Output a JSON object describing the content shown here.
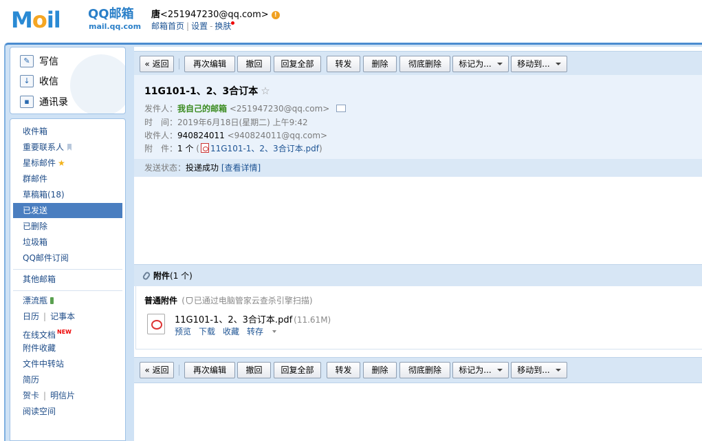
{
  "header": {
    "logo_text_m": "M",
    "logo_text_o": "o",
    "logo_text_il": "il",
    "logo_cn": "QQ邮箱",
    "logo_domain": "mail.qq.com",
    "user_name": "唐",
    "user_email": "<251947230@qq.com>",
    "warn_icon": "!",
    "links": {
      "home": "邮箱首页",
      "sep": "|",
      "settings": "设置",
      "dash": "-",
      "skin": "换肤"
    }
  },
  "sidebar": {
    "compose": "写信",
    "receive": "收信",
    "contacts": "通讯录",
    "folders": {
      "inbox": "收件箱",
      "vip": "重要联系人",
      "starred": "星标邮件",
      "groups": "群邮件",
      "drafts": "草稿箱(18)",
      "sent": "已发送",
      "deleted": "已删除",
      "spam": "垃圾箱",
      "subscriptions": "QQ邮件订阅",
      "other": "其他邮箱",
      "bottle": "漂流瓶",
      "calendar": "日历",
      "notes": "记事本",
      "docs": "在线文档",
      "new_badge": "NEW",
      "attach_fav": "附件收藏",
      "transfer": "文件中转站",
      "resume": "简历",
      "cards": "贺卡",
      "postcards": "明信片",
      "reading": "阅读空间",
      "vsep": "|"
    }
  },
  "toolbar": {
    "back": "« 返回",
    "reedit": "再次编辑",
    "recall": "撤回",
    "reply_all": "回复全部",
    "forward": "转发",
    "delete": "删除",
    "purge": "彻底删除",
    "mark_as": "标记为...",
    "move_to": "移动到..."
  },
  "mail": {
    "subject": "11G101-1、2、3合订本",
    "star": "☆",
    "from_label": "发件人：",
    "from_name": "我自己的邮箱",
    "from_addr": "<251947230@qq.com>",
    "time_label": "时　间：",
    "time_value": "2019年6月18日(星期二) 上午9:42",
    "to_label": "收件人：",
    "to_name": "940824011",
    "to_addr": "<940824011@qq.com>",
    "attach_label": "附　件：",
    "attach_count": "1 个",
    "attach_paren_open": "(",
    "attach_file": "11G101-1、2、3合订本.pdf",
    "attach_paren_close": ")",
    "status_label": "发送状态：",
    "status_value": "投递成功",
    "status_link": "[查看详情]"
  },
  "attachments": {
    "title": "附件",
    "count": "(1 个)",
    "type_label": "普通附件",
    "scan_open": "(",
    "scan_note": "已通过电脑管家云查杀引擎扫描",
    "scan_close": ")",
    "file_name": "11G101-1、2、3合订本.pdf",
    "file_size": "(11.61M)",
    "actions": {
      "preview": "预览",
      "download": "下载",
      "favorite": "收藏",
      "save_to": "转存"
    }
  }
}
